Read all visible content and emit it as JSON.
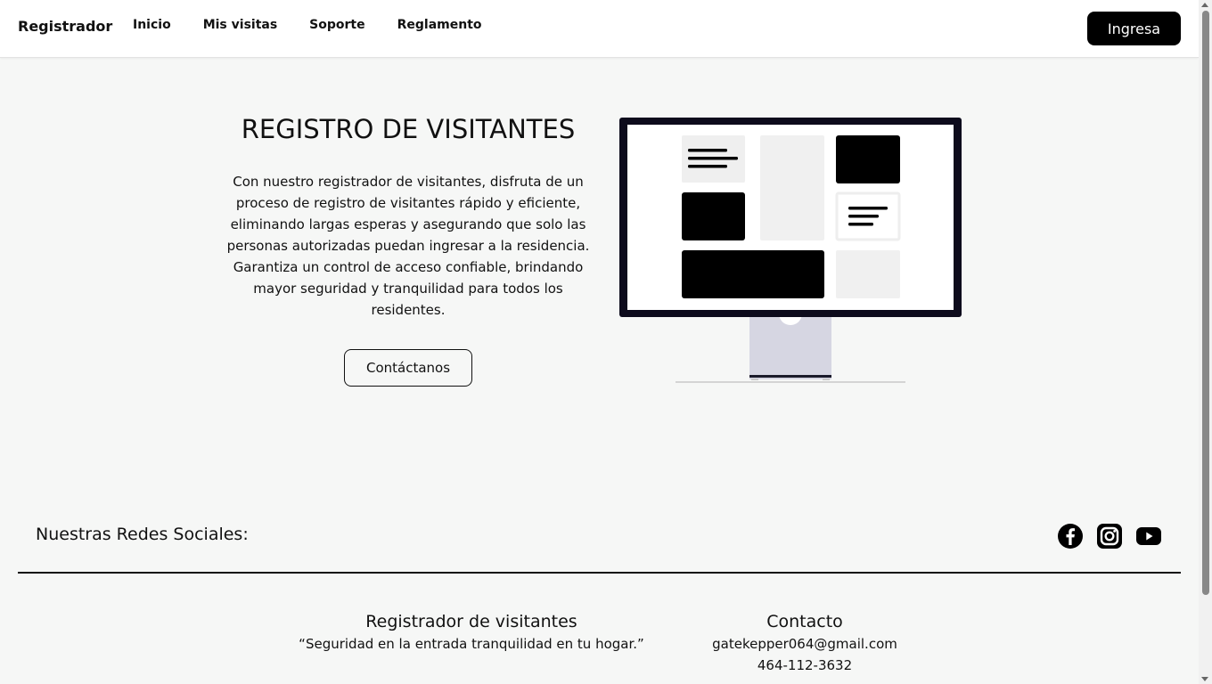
{
  "header": {
    "brand": "Registrador",
    "nav": [
      "Inicio",
      "Mis visitas",
      "Soporte",
      "Reglamento"
    ],
    "login_label": "Ingresa"
  },
  "hero": {
    "title": "REGISTRO DE VISITANTES",
    "description": "Con nuestro registrador de visitantes, disfruta de un proceso de registro de visitantes rápido y eficiente, eliminando largas esperas y asegurando que solo las personas autorizadas puedan ingresar a la residencia. Garantiza un control de acceso confiable, brindando mayor seguridad y tranquilidad para todos los residentes.",
    "contact_button": "Contáctanos",
    "illustration": "monitor-dashboard-illustration"
  },
  "social": {
    "title": "Nuestras Redes Sociales:",
    "icons": [
      "facebook-icon",
      "instagram-icon",
      "youtube-icon"
    ]
  },
  "footer": {
    "brand_heading": "Registrador de visitantes",
    "tagline": "“Seguridad en la entrada tranquilidad en tu hogar.”",
    "contact_heading": "Contacto",
    "email": "gatekepper064@gmail.com",
    "phone": "464-112-3632"
  },
  "colors": {
    "background": "#f6f7f6",
    "header": "#ffffff",
    "primary": "#000000"
  }
}
